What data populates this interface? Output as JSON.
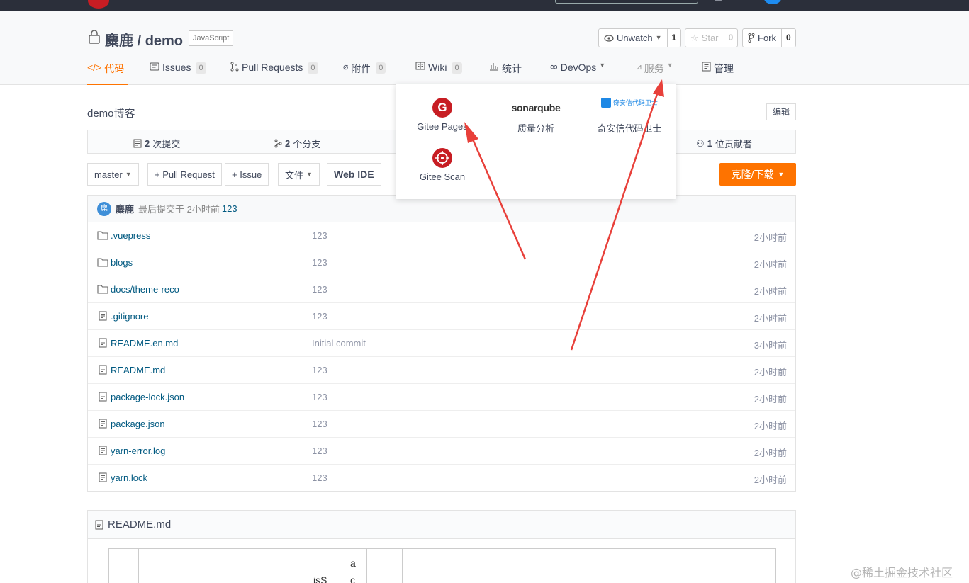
{
  "repo": {
    "owner": "麋鹿",
    "name": "demo",
    "separator": "/",
    "language": "JavaScript",
    "description": "demo博客",
    "edit_label": "编辑"
  },
  "actions": {
    "unwatch_label": "Unwatch",
    "unwatch_count": "1",
    "star_label": "Star",
    "star_count": "0",
    "fork_label": "Fork",
    "fork_count": "0"
  },
  "nav": [
    {
      "label": "代码"
    },
    {
      "label": "Issues",
      "count": "0"
    },
    {
      "label": "Pull Requests",
      "count": "0"
    },
    {
      "label": "附件",
      "count": "0"
    },
    {
      "label": "Wiki",
      "count": "0"
    },
    {
      "label": "统计"
    },
    {
      "label": "DevOps"
    },
    {
      "label": "服务"
    },
    {
      "label": "管理"
    }
  ],
  "stats": {
    "commits_num": "2",
    "commits_label": "次提交",
    "branches_num": "2",
    "branches_label": "个分支",
    "contributors_num": "1",
    "contributors_label": "位贡献者"
  },
  "toolbar": {
    "branch": "master",
    "pull_request": "+ Pull Request",
    "issue": "+ Issue",
    "file": "文件",
    "web_ide": "Web IDE",
    "clone": "克隆/下载"
  },
  "last_commit": {
    "avatar_text": "麋",
    "author": "麋鹿",
    "text": "最后提交于 2小时前",
    "message": "123"
  },
  "files": [
    {
      "name": ".vuepress",
      "type": "folder",
      "message": "123",
      "time": "2小时前"
    },
    {
      "name": "blogs",
      "type": "folder",
      "message": "123",
      "time": "2小时前"
    },
    {
      "name": "docs/theme-reco",
      "type": "folder",
      "message": "123",
      "time": "2小时前"
    },
    {
      "name": ".gitignore",
      "type": "file",
      "message": "123",
      "time": "2小时前"
    },
    {
      "name": "README.en.md",
      "type": "file",
      "message": "Initial commit",
      "time": "3小时前"
    },
    {
      "name": "README.md",
      "type": "file",
      "message": "123",
      "time": "2小时前"
    },
    {
      "name": "package-lock.json",
      "type": "file",
      "message": "123",
      "time": "2小时前"
    },
    {
      "name": "package.json",
      "type": "file",
      "message": "123",
      "time": "2小时前"
    },
    {
      "name": "yarn-error.log",
      "type": "file",
      "message": "123",
      "time": "2小时前"
    },
    {
      "name": "yarn.lock",
      "type": "file",
      "message": "123",
      "time": "2小时前"
    }
  ],
  "readme": {
    "title": "README.md",
    "cell_a": "a",
    "cell_c": "c",
    "cell_iss": "isS"
  },
  "services_menu": [
    {
      "label": "Gitee Pages",
      "icon": "gitee-pages-icon"
    },
    {
      "label": "质量分析",
      "icon": "sonarqube-logo",
      "logo_text": "sonarqube"
    },
    {
      "label": "奇安信代码卫士",
      "icon": "qianxin-logo",
      "logo_text": "奇安信代码卫士"
    },
    {
      "label": "Gitee Scan",
      "icon": "gitee-scan-icon"
    }
  ],
  "watermark": "@稀土掘金技术社区",
  "colors": {
    "accent": "#fe7300",
    "brand_red": "#c71d23",
    "link": "#005980",
    "arrow": "#e8403a"
  }
}
